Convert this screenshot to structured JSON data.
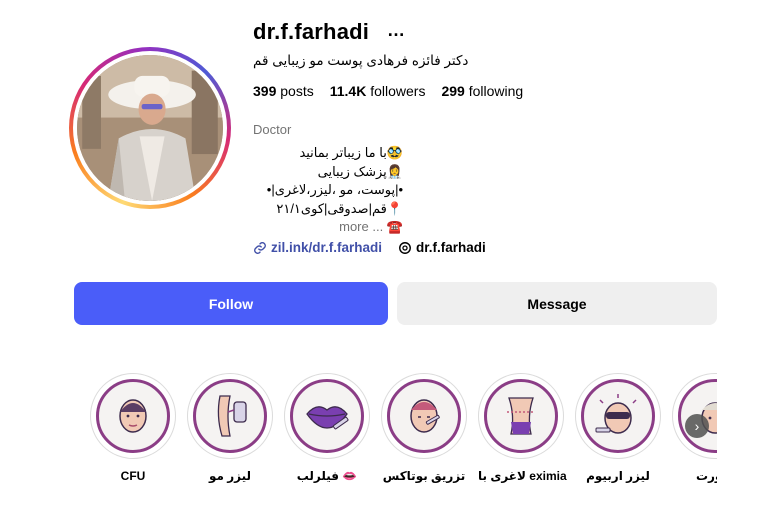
{
  "profile": {
    "username": "dr.f.farhadi",
    "more_icon": "…",
    "full_name": "دکتر فائزه فرهادی پوست مو زیبایی قم",
    "stats": {
      "posts_count": "399",
      "posts_label": "posts",
      "followers_count": "11.4K",
      "followers_label": "followers",
      "following_count": "299",
      "following_label": "following"
    },
    "category": "Doctor",
    "bio_lines": [
      "🥸با ما زیباتر بمانید",
      "👩‍⚕️پزشک زیبایی",
      "•|پوست، مو ،لیزر،لاغری|•",
      "📍قم|صدوقی|کوی۲۱/۱",
      "☎️"
    ],
    "bio_more": "... more",
    "link_text": "zil.ink/dr.f.farhadi",
    "threads_text": "dr.f.farhadi"
  },
  "actions": {
    "follow_label": "Follow",
    "message_label": "Message"
  },
  "highlights": [
    {
      "label": "CFU",
      "icon": "face-icon"
    },
    {
      "label": "لیزر مو",
      "icon": "laser-leg-icon"
    },
    {
      "label": "فیلرلب 👄",
      "icon": "lips-icon"
    },
    {
      "label": "تزریق بوتاکس",
      "icon": "botox-face-icon"
    },
    {
      "label": "لاغری با eximia",
      "icon": "body-icon"
    },
    {
      "label": "لیزر اربیوم",
      "icon": "laser-face-icon"
    },
    {
      "label": "صورت",
      "icon": "face-mask-icon"
    }
  ],
  "colors": {
    "follow_bg": "#4a5df9",
    "message_bg": "#efefef",
    "link": "#4150a8",
    "highlight_ring": "#8b3d86"
  }
}
